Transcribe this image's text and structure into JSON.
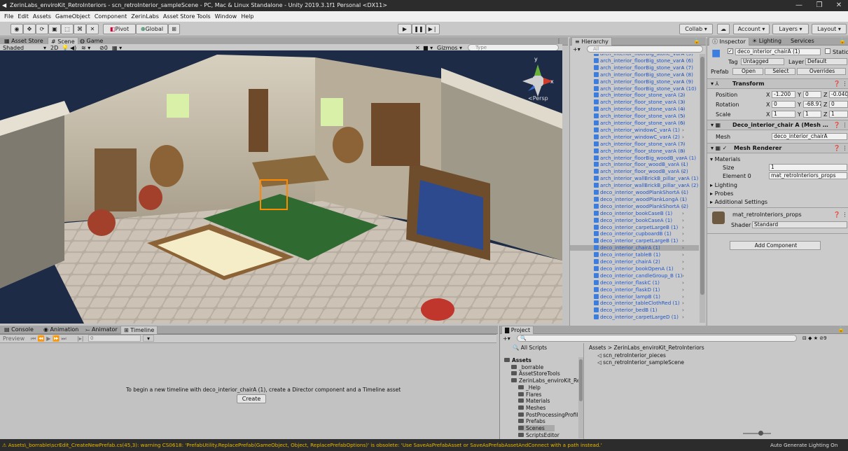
{
  "window": {
    "title": "ZerinLabs_enviroKit_RetroInteriors - scn_retroInterior_sampleScene - PC, Mac & Linux Standalone - Unity 2019.3.1f1 Personal <DX11>",
    "unity_glyph": "◀"
  },
  "menu": [
    "File",
    "Edit",
    "Assets",
    "GameObject",
    "Component",
    "ZerinLabs",
    "Asset Store Tools",
    "Window",
    "Help"
  ],
  "toolbar": {
    "pivot_label": "Pivot",
    "global_label": "Global",
    "collab_label": "Collab ▾",
    "account_label": "Account",
    "layers_label": "Layers",
    "layout_label": "Layout"
  },
  "scene_tabs": {
    "asset_store": "Asset Store",
    "scene": "Scene",
    "game": "Game"
  },
  "scene_bar": {
    "shaded": "Shaded",
    "mode_2d": "2D",
    "gizmos": "Gizmos",
    "search_placeholder": "Type",
    "fx_count": "0"
  },
  "scene_view": {
    "persp_label": "<Persp",
    "axis_x": "x",
    "axis_y": "y"
  },
  "hierarchy": {
    "title": "Hierarchy",
    "search_placeholder": "All",
    "items": [
      "arch_interior_floorBig_stone_varA (5)",
      "arch_interior_floorBig_stone_varA (6)",
      "arch_interior_floorBig_stone_varA (7)",
      "arch_interior_floorBig_stone_varA (8)",
      "arch_interior_floorBig_stone_varA (9)",
      "arch_interior_floorBig_stone_varA (10)",
      "arch_interior_floor_stone_varA (2)",
      "arch_interior_floor_stone_varA (3)",
      "arch_interior_floor_stone_varA (4)",
      "arch_interior_floor_stone_varA (5)",
      "arch_interior_floor_stone_varA (6)",
      "arch_interior_windowC_varA (1)",
      "arch_interior_windowC_varA (2)",
      "arch_interior_floor_stone_varA (7)",
      "arch_interior_floor_stone_varA (8)",
      "arch_interior_floorBig_woodB_varA (1)",
      "arch_interior_floor_woodB_varA (1)",
      "arch_interior_floor_woodB_varA (2)",
      "arch_interior_wallBrickB_pillar_varA (1)",
      "arch_interior_wallBrickB_pillar_varA (2)",
      "deco_interior_woodPlankShortA (1)",
      "deco_interior_woodPlankLongA (1)",
      "deco_interior_woodPlankShortA (2)",
      "deco_interior_bookCaseB (1)",
      "deco_interior_bookCaseA (1)",
      "deco_interior_carpetLargeB (1)",
      "deco_interior_cupboardB (1)",
      "deco_interior_carpetLargeB (1)",
      "deco_interior_chairA (1)",
      "deco_interior_tableB (1)",
      "deco_interior_chairA (2)",
      "deco_interior_bookOpenA (1)",
      "deco_interior_candleGroup_B (1)",
      "deco_interior_flaskC (1)",
      "deco_interior_flaskD (1)",
      "deco_interior_lampB (1)",
      "deco_interior_tableClothRed (1)",
      "deco_interior_bedB (1)",
      "deco_interior_carpetLargeD (1)"
    ],
    "selected_index": 28
  },
  "inspector": {
    "tab_inspector": "Inspector",
    "tab_lighting": "Lighting",
    "tab_services": "Services",
    "object_name": "deco_interior_chairA (1)",
    "static_label": "Static",
    "tag_label": "Tag",
    "tag_value": "Untagged",
    "layer_label": "Layer",
    "layer_value": "Default",
    "prefab_label": "Prefab",
    "open_btn": "Open",
    "select_btn": "Select",
    "overrides_btn": "Overrides",
    "transform": {
      "title": "Transform",
      "position_label": "Position",
      "rotation_label": "Rotation",
      "scale_label": "Scale",
      "pos": [
        "-1.200",
        "0",
        "-0.040"
      ],
      "rot": [
        "0",
        "-68.97",
        "0"
      ],
      "scale": [
        "1",
        "1",
        "1"
      ]
    },
    "mesh_filter": {
      "title": "Deco_interior_chair A (Mesh Filter)",
      "mesh_label": "Mesh",
      "mesh_value": "deco_interior_chairA"
    },
    "mesh_renderer": {
      "title": "Mesh Renderer",
      "materials_label": "Materials",
      "size_label": "Size",
      "size_value": "1",
      "element_label": "Element 0",
      "element_value": "mat_retroInteriors_props",
      "lighting": "Lighting",
      "probes": "Probes",
      "additional": "Additional Settings"
    },
    "material": {
      "name": "mat_retroInteriors_props",
      "shader_label": "Shader",
      "shader_value": "Standard"
    },
    "add_component": "Add Component"
  },
  "bottom_tabs": {
    "console": "Console",
    "animation": "Animation",
    "animator": "Animator",
    "timeline": "Timeline"
  },
  "timeline": {
    "preview_label": "Preview",
    "frame_value": "0",
    "message": "To begin a new timeline with deco_interior_chairA (1), create a Director component and a Timeline asset",
    "create_btn": "Create"
  },
  "project": {
    "title": "Project",
    "all_scripts": "All Scripts",
    "assets_root": "Assets",
    "breadcrumb_sep": ">",
    "breadcrumb_folder": "ZerinLabs_enviroKit_RetroInteriors",
    "files": [
      "scn_retroInterior_pieces",
      "scn_retroInterior_sampleScene"
    ],
    "hidden_count": "9",
    "tree": [
      {
        "label": "Assets",
        "indent": 0,
        "bold": true
      },
      {
        "label": "_borrable",
        "indent": 1
      },
      {
        "label": "AssetStoreTools",
        "indent": 1
      },
      {
        "label": "ZerinLabs_enviroKit_Ret",
        "indent": 1
      },
      {
        "label": "_Help",
        "indent": 2
      },
      {
        "label": "Flares",
        "indent": 2
      },
      {
        "label": "Materials",
        "indent": 2
      },
      {
        "label": "Meshes",
        "indent": 2
      },
      {
        "label": "PostProcessingProfile",
        "indent": 2
      },
      {
        "label": "Prefabs",
        "indent": 2
      },
      {
        "label": "Scenes",
        "indent": 2,
        "selected": true
      },
      {
        "label": "ScriptsEditor",
        "indent": 2
      }
    ]
  },
  "status": {
    "warning": "Assets\\_borrable\\scrEdit_CreateNewPrefab.cs(45,3): warning CS0618: 'PrefabUtility.ReplacePrefab(GameObject, Object, ReplacePrefabOptions)' is obsolete: 'Use SaveAsPrefabAsset or SaveAsPrefabAssetAndConnect with a path instead.'",
    "right": "Auto Generate Lighting On"
  },
  "colors": {
    "selection_blue": "#3b7ee0",
    "warning_yellow": "#e6b800",
    "scene_sky": "#1c2a44"
  }
}
